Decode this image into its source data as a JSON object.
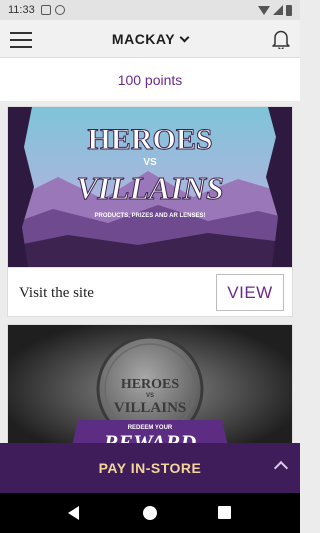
{
  "status": {
    "time": "11:33"
  },
  "header": {
    "store_name": "MACKAY"
  },
  "points": {
    "text": "100 points"
  },
  "promo_card": {
    "banner": {
      "title_line1": "HEROES",
      "title_vs": "VS",
      "title_line2": "VILLAINS",
      "tagline": "PRODUCTS, PRIZES AND AR LENSES!"
    },
    "link_text": "Visit the site",
    "button_label": "VIEW"
  },
  "reward_card": {
    "coin_line1": "HEROES",
    "coin_vs": "VS",
    "coin_line2": "VILLAINS",
    "ribbon_small": "REDEEM YOUR",
    "ribbon_big": "REWARD"
  },
  "bottom_bar": {
    "label": "PAY IN-STORE"
  },
  "colors": {
    "accent": "#6b2a8f",
    "pay_bar": "#3e1d5a",
    "pay_text": "#f3d59c"
  }
}
